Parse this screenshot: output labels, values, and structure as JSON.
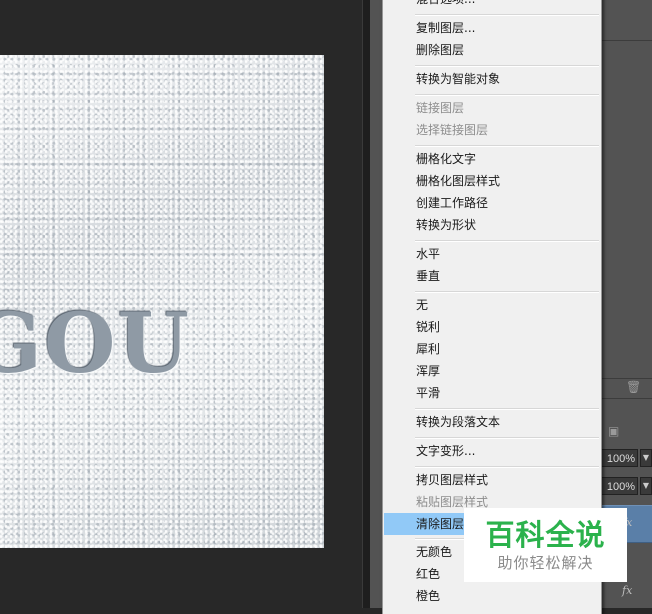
{
  "canvas": {
    "art_text": "GOU"
  },
  "context_menu": {
    "items": [
      {
        "label": "混合选项...",
        "disabled": false
      },
      {
        "label": "复制图层...",
        "disabled": false
      },
      {
        "label": "删除图层",
        "disabled": false
      },
      {
        "label": "转换为智能对象",
        "disabled": false
      },
      {
        "label": "链接图层",
        "disabled": true
      },
      {
        "label": "选择链接图层",
        "disabled": true
      },
      {
        "label": "栅格化文字",
        "disabled": false
      },
      {
        "label": "栅格化图层样式",
        "disabled": false
      },
      {
        "label": "创建工作路径",
        "disabled": false
      },
      {
        "label": "转换为形状",
        "disabled": false
      },
      {
        "label": "水平",
        "disabled": false
      },
      {
        "label": "垂直",
        "disabled": false
      },
      {
        "label": "无",
        "disabled": false
      },
      {
        "label": "锐利",
        "disabled": false
      },
      {
        "label": "犀利",
        "disabled": false
      },
      {
        "label": "浑厚",
        "disabled": false
      },
      {
        "label": "平滑",
        "disabled": false
      },
      {
        "label": "转换为段落文本",
        "disabled": false
      },
      {
        "label": "文字变形...",
        "disabled": false
      },
      {
        "label": "拷贝图层样式",
        "disabled": false
      },
      {
        "label": "粘贴图层样式",
        "disabled": true
      },
      {
        "label": "清除图层样式",
        "disabled": false,
        "highlighted": true
      },
      {
        "label": "无颜色",
        "disabled": false
      },
      {
        "label": "红色",
        "disabled": false
      },
      {
        "label": "橙色",
        "disabled": false
      }
    ]
  },
  "layers_panel": {
    "opacity_value": "100%",
    "fill_value": "100%",
    "fx_label": "fx",
    "trash_icon": "trash-icon",
    "lock_icon": "lock-icon"
  },
  "watermark": {
    "title": "百科全说",
    "subtitle": "助你轻松解决"
  },
  "colors": {
    "workspace_bg": "#282828",
    "panel_bg": "#535353",
    "menu_bg": "#f0f0f0",
    "menu_highlight": "#91c9f7",
    "selected_layer": "#5a7fa8",
    "watermark_green": "#2bb24c"
  }
}
